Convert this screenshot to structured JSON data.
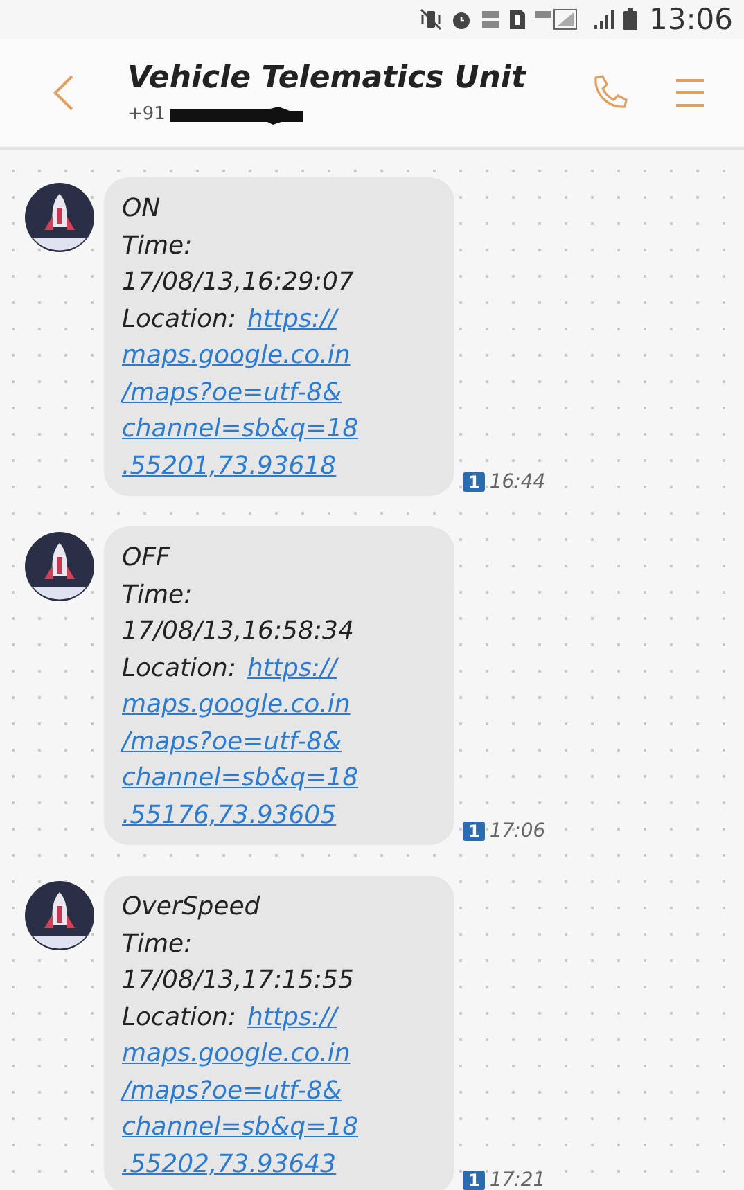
{
  "status_bar": {
    "time": "13:06"
  },
  "header": {
    "title": "Vehicle Telematics Unit",
    "number_prefix": "+91"
  },
  "messages": [
    {
      "lines": [
        "ON",
        "Time:",
        "17/08/13,16:29:07"
      ],
      "location_label": "Location:",
      "url_lines": [
        "https://",
        "maps.google.co.in",
        "/maps?oe=utf-8&",
        "channel=sb&q=18",
        ".55201,73.93618"
      ],
      "sim": "1",
      "time": "16:44"
    },
    {
      "lines": [
        "OFF",
        "Time:",
        "17/08/13,16:58:34"
      ],
      "location_label": "Location:",
      "url_lines": [
        "https://",
        "maps.google.co.in",
        "/maps?oe=utf-8&",
        "channel=sb&q=18",
        ".55176,73.93605"
      ],
      "sim": "1",
      "time": "17:06"
    },
    {
      "lines": [
        "OverSpeed",
        "Time:",
        "17/08/13,17:15:55"
      ],
      "location_label": "Location:",
      "url_lines": [
        "https://",
        "maps.google.co.in",
        "/maps?oe=utf-8&",
        "channel=sb&q=18",
        ".55202,73.93643"
      ],
      "sim": "1",
      "time": "17:21"
    }
  ]
}
